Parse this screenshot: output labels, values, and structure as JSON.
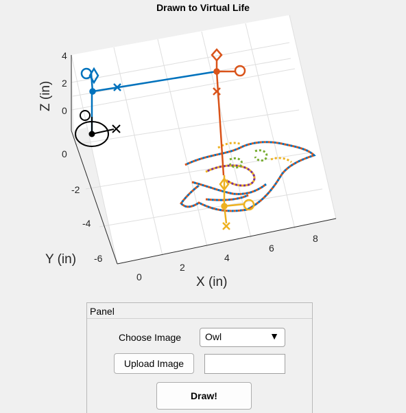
{
  "plot": {
    "title": "Drawn to Virtual Life",
    "xlabel": "X (in)",
    "ylabel": "Y (in)",
    "zlabel": "Z (in)",
    "xticks": [
      "0",
      "2",
      "4",
      "6",
      "8"
    ],
    "yticks": [
      "0",
      "-2",
      "-4",
      "-6"
    ],
    "zticks": [
      "4",
      "2",
      "0"
    ],
    "colors": {
      "blue": "#0072bd",
      "orange": "#d95319",
      "yellow": "#edb120",
      "black": "#000000",
      "grid": "#dedede"
    }
  },
  "panel": {
    "title": "Panel",
    "choose_label": "Choose Image",
    "select_value": "Owl",
    "select_arrow": "▼",
    "upload_label": "Upload Image",
    "upload_value": "",
    "draw_label": "Draw!"
  }
}
